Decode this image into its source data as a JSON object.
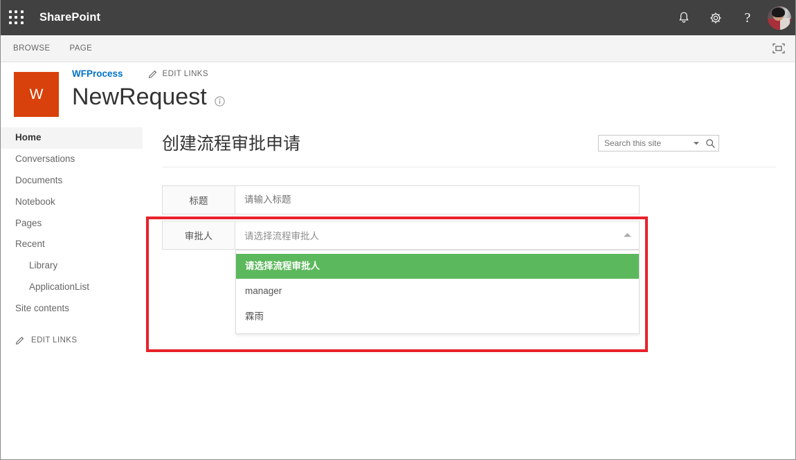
{
  "suite": {
    "app_launcher": "app-launcher",
    "brand": "SharePoint",
    "icons": [
      {
        "name": "notifications-icon",
        "glyph": "bell"
      },
      {
        "name": "settings-icon",
        "glyph": "gear"
      },
      {
        "name": "help-icon",
        "glyph": "?"
      }
    ],
    "avatar_alt": "user-avatar"
  },
  "ribbon": {
    "tabs": [
      {
        "label": "BROWSE"
      },
      {
        "label": "PAGE"
      }
    ],
    "focus_button": "focus-on-content"
  },
  "site": {
    "logo_letter": "W",
    "breadcrumb": "WFProcess",
    "edit_links_label": "EDIT LINKS",
    "page_title": "NewRequest",
    "info_icon": "info-icon"
  },
  "search": {
    "placeholder": "Search this site",
    "value": ""
  },
  "quicklaunch": {
    "items": [
      {
        "label": "Home",
        "selected": true,
        "child": false
      },
      {
        "label": "Conversations",
        "selected": false,
        "child": false
      },
      {
        "label": "Documents",
        "selected": false,
        "child": false
      },
      {
        "label": "Notebook",
        "selected": false,
        "child": false
      },
      {
        "label": "Pages",
        "selected": false,
        "child": false
      },
      {
        "label": "Recent",
        "selected": false,
        "child": false
      },
      {
        "label": "Library",
        "selected": false,
        "child": true
      },
      {
        "label": "ApplicationList",
        "selected": false,
        "child": true
      },
      {
        "label": "Site contents",
        "selected": false,
        "child": false
      }
    ],
    "edit_links_label": "EDIT LINKS"
  },
  "main": {
    "heading": "创建流程审批申请",
    "form": {
      "title_field": {
        "label": "标题",
        "placeholder": "请输入标题",
        "value": ""
      },
      "approver_field": {
        "label": "审批人",
        "selected_display": "请选择流程审批人",
        "expanded": true,
        "options": [
          {
            "label": "请选择流程审批人",
            "highlighted": true
          },
          {
            "label": "manager",
            "highlighted": false
          },
          {
            "label": "霖雨",
            "highlighted": false
          }
        ]
      }
    }
  },
  "colors": {
    "suite_bar": "#414141",
    "logo": "#d8410b",
    "breadcrumb_link": "#0072c6",
    "dropdown_highlight": "#5cb85c",
    "annotation_box": "#e8212b"
  }
}
